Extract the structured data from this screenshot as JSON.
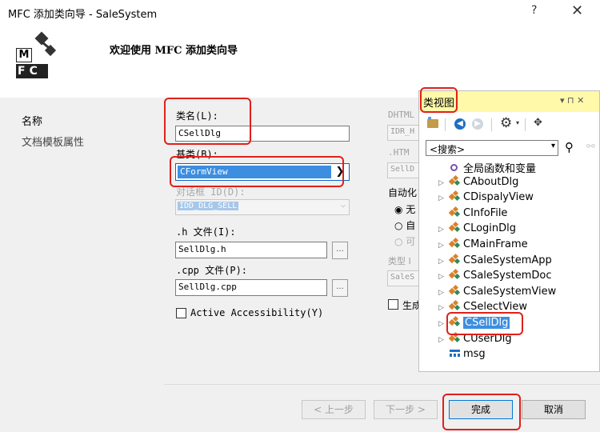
{
  "window": {
    "title": "MFC 添加类向导 - SaleSystem",
    "help": "?",
    "close": "✕"
  },
  "header": {
    "welcome": "欢迎使用 MFC 添加类向导",
    "logo_top": "M",
    "logo_bottom": "FC"
  },
  "nav": {
    "items": [
      "名称",
      "文档模板属性"
    ]
  },
  "form": {
    "class_name_label": "类名(L):",
    "class_name_value": "CSellDlg",
    "base_class_label": "基类(B):",
    "base_class_value": "CFormView",
    "dialog_id_label": "对话框 ID(D):",
    "dialog_id_value": "IDD_DLG_SELL",
    "h_file_label": ".h 文件(I):",
    "h_file_value": "SellDlg.h",
    "cpp_file_label": ".cpp 文件(P):",
    "cpp_file_value": "SellDlg.cpp",
    "browse_label": "...",
    "accessibility_label": "Active Accessibility(Y)",
    "dhtml_label": "DHTML",
    "dhtml_value": "IDR_H",
    "htm_label": ".HTM",
    "htm_value": "SellD",
    "auto_label": "自动化",
    "radio1": "无",
    "radio2": "自",
    "radio3": "可",
    "type_label": "类型 I",
    "type_value": "SaleS",
    "generate_label": "生成"
  },
  "buttons": {
    "prev": "< 上一步",
    "next": "下一步 >",
    "finish": "完成",
    "cancel": "取消"
  },
  "classview": {
    "title": "类视图",
    "pin": "▾ ⊓ ✕",
    "search_placeholder": "<搜索>",
    "items": [
      {
        "label": "全局函数和变量",
        "type": "global",
        "expand": false
      },
      {
        "label": "CAboutDlg",
        "type": "class",
        "expand": true
      },
      {
        "label": "CDispalyView",
        "type": "class",
        "expand": true
      },
      {
        "label": "CInfoFile",
        "type": "class",
        "expand": false
      },
      {
        "label": "CLoginDlg",
        "type": "class",
        "expand": true
      },
      {
        "label": "CMainFrame",
        "type": "class",
        "expand": true
      },
      {
        "label": "CSaleSystemApp",
        "type": "class",
        "expand": true
      },
      {
        "label": "CSaleSystemDoc",
        "type": "class",
        "expand": true
      },
      {
        "label": "CSaleSystemView",
        "type": "class",
        "expand": true
      },
      {
        "label": "CSelectView",
        "type": "class",
        "expand": true
      },
      {
        "label": "CSellDlg",
        "type": "class",
        "expand": true,
        "selected": true
      },
      {
        "label": "CUserDlg",
        "type": "class",
        "expand": true
      },
      {
        "label": "msg",
        "type": "struct",
        "expand": false
      }
    ]
  },
  "colors": {
    "highlight_red": "#e0201b",
    "selection_blue": "#3d8ee0",
    "classview_title_bg": "#fff9a9"
  }
}
